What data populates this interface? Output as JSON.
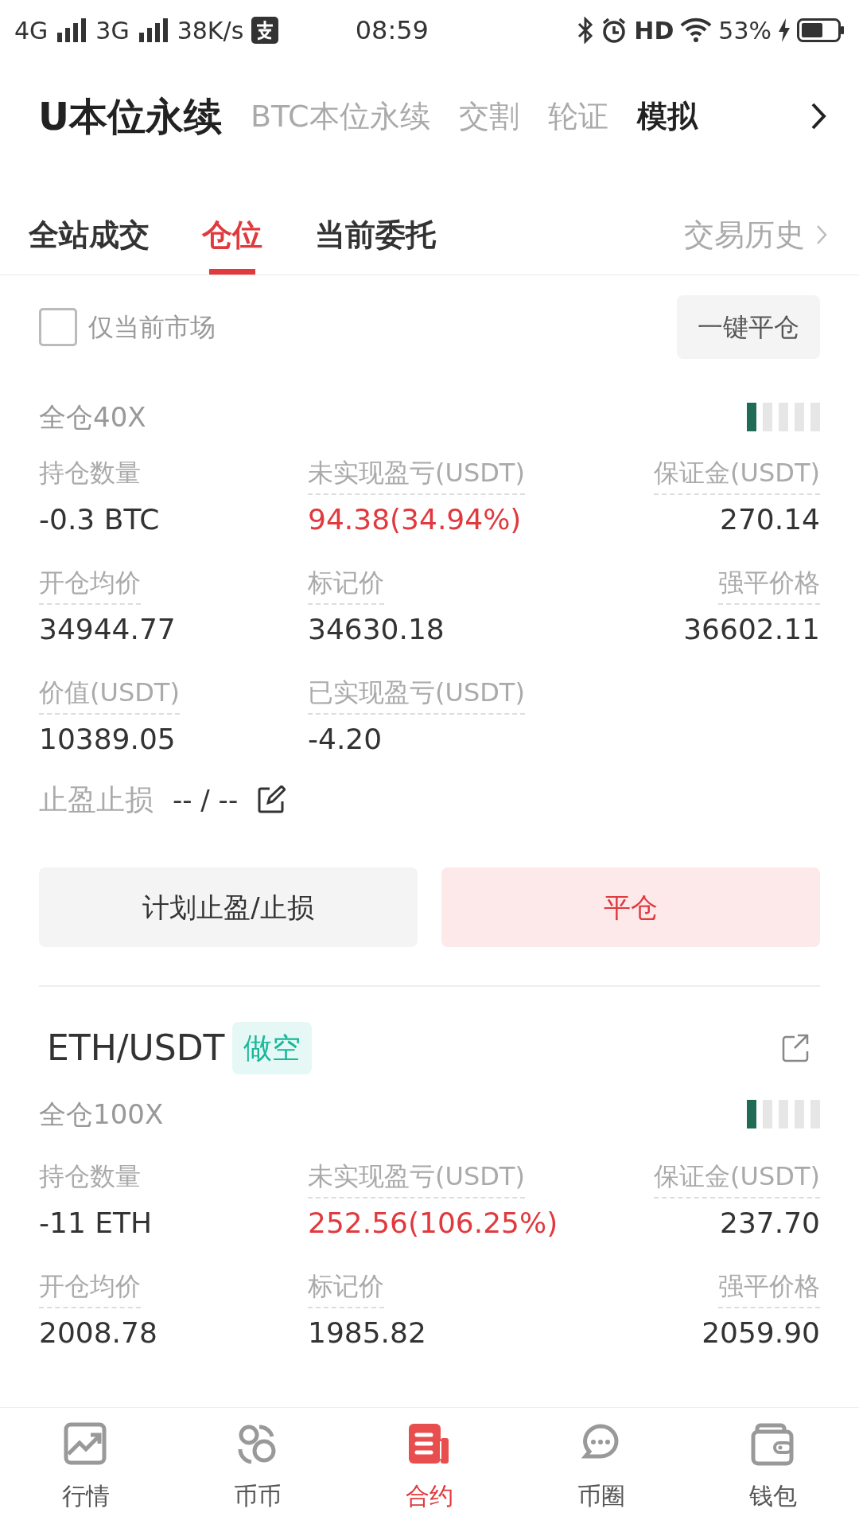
{
  "status_bar": {
    "left": [
      "4G",
      "3G",
      "38K/s"
    ],
    "time": "08:59",
    "hd": "HD",
    "battery": "53%"
  },
  "top_tabs": [
    {
      "label": "U本位永续",
      "selected": true
    },
    {
      "label": "BTC本位永续",
      "selected": false
    },
    {
      "label": "交割",
      "selected": false
    },
    {
      "label": "轮证",
      "selected": false
    },
    {
      "label": "模拟",
      "selected": false,
      "bold": true
    }
  ],
  "sub_tabs": [
    {
      "label": "全站成交",
      "selected": false
    },
    {
      "label": "仓位",
      "selected": true
    },
    {
      "label": "当前委托",
      "selected": false
    }
  ],
  "history_link": "交易历史",
  "filter": {
    "label": "仅当前市场",
    "checked": false
  },
  "close_all_button": "一键平仓",
  "positions": [
    {
      "leverage": "全仓40X",
      "level": 0.2,
      "fields": [
        {
          "label": "持仓数量",
          "value": "-0.3 BTC",
          "underlined": false,
          "highlight": false
        },
        {
          "label": "未实现盈亏(USDT)",
          "value": "94.38(34.94%)",
          "underlined": true,
          "highlight": true
        },
        {
          "label": "保证金(USDT)",
          "value": "270.14",
          "underlined": true,
          "highlight": false
        },
        {
          "label": "开仓均价",
          "value": "34944.77",
          "underlined": true,
          "highlight": false
        },
        {
          "label": "标记价",
          "value": "34630.18",
          "underlined": true,
          "highlight": false
        },
        {
          "label": "强平价格",
          "value": "36602.11",
          "underlined": true,
          "highlight": false
        },
        {
          "label": "价值(USDT)",
          "value": "10389.05",
          "underlined": true,
          "highlight": false
        },
        {
          "label": "已实现盈亏(USDT)",
          "value": "-4.20",
          "underlined": true,
          "highlight": false
        }
      ],
      "tpsl": {
        "label": "止盈止损",
        "value": "-- / --"
      },
      "buttons": [
        "计划止盈/止损",
        "平仓"
      ]
    },
    {
      "symbol": "ETH/USDT",
      "side": "做空",
      "leverage": "全仓100X",
      "level": 0.2,
      "fields": [
        {
          "label": "持仓数量",
          "value": "-11 ETH",
          "underlined": false,
          "highlight": false
        },
        {
          "label": "未实现盈亏(USDT)",
          "value": "252.56(106.25%)",
          "underlined": true,
          "highlight": true
        },
        {
          "label": "保证金(USDT)",
          "value": "237.70",
          "underlined": true,
          "highlight": false
        },
        {
          "label": "开仓均价",
          "value": "2008.78",
          "underlined": true,
          "highlight": false
        },
        {
          "label": "标记价",
          "value": "1985.82",
          "underlined": true,
          "highlight": false
        },
        {
          "label": "强平价格",
          "value": "2059.90",
          "underlined": true,
          "highlight": false
        }
      ]
    }
  ],
  "bottom_nav": [
    {
      "label": "行情",
      "selected": false,
      "kind": "chart"
    },
    {
      "label": "币币",
      "selected": false,
      "kind": "swap"
    },
    {
      "label": "合约",
      "selected": true,
      "kind": "contract"
    },
    {
      "label": "币圈",
      "selected": false,
      "kind": "chat"
    },
    {
      "label": "钱包",
      "selected": false,
      "kind": "wallet"
    }
  ]
}
